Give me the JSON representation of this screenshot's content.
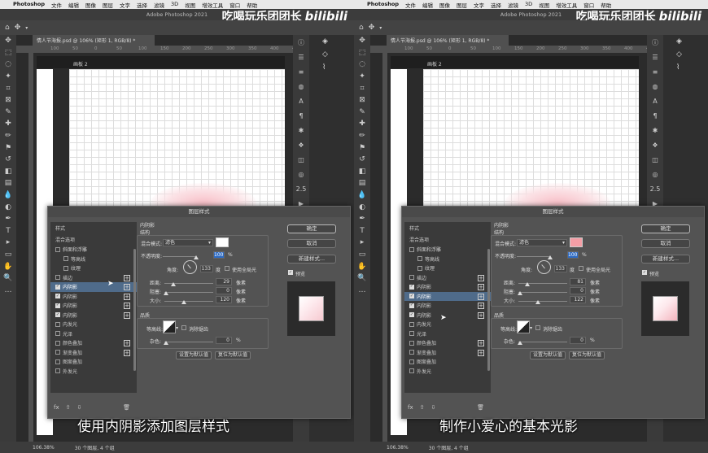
{
  "menubar": {
    "apple": "",
    "items": [
      "Photoshop",
      "文件",
      "编辑",
      "图像",
      "图层",
      "文字",
      "选择",
      "滤镜",
      "3D",
      "视图",
      "增效工具",
      "窗口",
      "帮助"
    ]
  },
  "window_title": "Adobe Photoshop 2021",
  "watermark": {
    "text": "吃喝玩乐团团长",
    "logo": "bilibili"
  },
  "document_tab": "情人节海报.psd @ 106% (矩形 1, RGB/8) *",
  "artboard_label": "画板 2",
  "ruler_ticks": [
    "100",
    "50",
    "0",
    "50",
    "100",
    "150",
    "200",
    "250",
    "300",
    "350",
    "400",
    "450"
  ],
  "status": {
    "zoom": "106.38%",
    "info": "30 个图层, 4 个组"
  },
  "dialog": {
    "title": "图层样式",
    "list_header": "样式",
    "blend_options": "混合选项",
    "section": "内阴影",
    "sub_structure": "结构",
    "blend_mode_label": "混合模式:",
    "blend_mode_value": "滤色",
    "opacity_label": "不透明度:",
    "opacity_unit": "%",
    "angle_label": "角度:",
    "angle_value": "133",
    "angle_unit": "度",
    "global_light": "使用全局光",
    "distance_label": "距离:",
    "choke_label": "阻塞:",
    "size_label": "大小:",
    "px_unit": "像素",
    "quality_header": "品质",
    "contour_label": "等高线:",
    "antialias": "消除锯齿",
    "noise_label": "杂色:",
    "noise_value": "0",
    "set_default": "设置为默认值",
    "reset_default": "复位为默认值",
    "ok": "确定",
    "cancel": "取消",
    "new_style": "新建样式...",
    "preview": "预览"
  },
  "styles": [
    {
      "label": "斜面和浮雕",
      "checked": false,
      "plus": false,
      "indent": 0
    },
    {
      "label": "等高线",
      "checked": false,
      "plus": false,
      "indent": 1
    },
    {
      "label": "纹理",
      "checked": false,
      "plus": false,
      "indent": 1
    },
    {
      "label": "描边",
      "checked": false,
      "plus": true,
      "indent": 0
    },
    {
      "label": "内阴影",
      "checked": true,
      "plus": true,
      "indent": 0
    },
    {
      "label": "内阴影",
      "checked": true,
      "plus": true,
      "indent": 0
    },
    {
      "label": "内阴影",
      "checked": true,
      "plus": true,
      "indent": 0
    },
    {
      "label": "内阴影",
      "checked": true,
      "plus": true,
      "indent": 0
    },
    {
      "label": "内发光",
      "checked": false,
      "plus": false,
      "indent": 0
    },
    {
      "label": "光泽",
      "checked": false,
      "plus": false,
      "indent": 0
    },
    {
      "label": "颜色叠加",
      "checked": false,
      "plus": true,
      "indent": 0
    },
    {
      "label": "渐变叠加",
      "checked": false,
      "plus": true,
      "indent": 0
    },
    {
      "label": "图案叠加",
      "checked": false,
      "plus": false,
      "indent": 0
    },
    {
      "label": "外发光",
      "checked": false,
      "plus": false,
      "indent": 0
    }
  ],
  "left": {
    "opacity": "100",
    "distance": "29",
    "choke": "0",
    "size": "120",
    "color": "#ffffff",
    "selected_row": 4,
    "subtitle": "使用内阴影添加图层样式"
  },
  "right": {
    "opacity": "100",
    "distance": "81",
    "choke": "0",
    "size": "122",
    "color": "#f49ea6",
    "selected_row": 5,
    "subtitle": "制作小爱心的基本光影"
  }
}
